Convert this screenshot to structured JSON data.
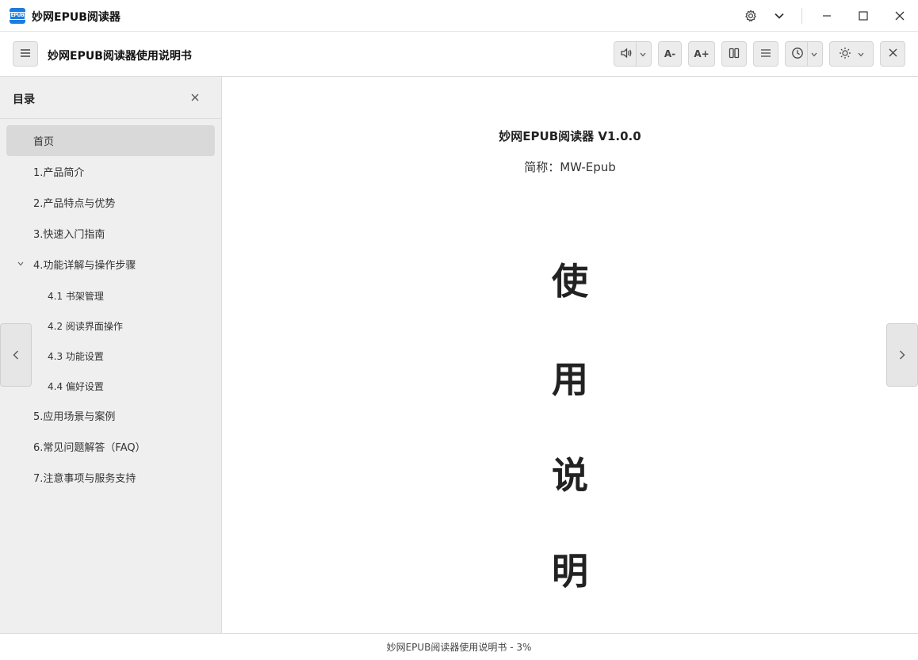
{
  "window": {
    "app_logo_text": "EPUB",
    "title": "妙网EPUB阅读器",
    "icons": [
      "gear-icon",
      "chevron-down-icon",
      "minimize-icon",
      "maximize-icon",
      "close-icon"
    ]
  },
  "toolbar": {
    "doc_title": "妙网EPUB阅读器使用说明书",
    "font_decrease_label": "A-",
    "font_increase_label": "A+",
    "icons": [
      "menu-icon",
      "speaker-icon",
      "two-column-icon",
      "list-icon",
      "clock-icon",
      "sun-icon",
      "close-icon"
    ]
  },
  "sidebar": {
    "title": "目录",
    "items": [
      {
        "label": "首页",
        "level": 0,
        "active": true
      },
      {
        "label": "1.产品简介",
        "level": 0
      },
      {
        "label": "2.产品特点与优势",
        "level": 0
      },
      {
        "label": "3.快速入门指南",
        "level": 0
      },
      {
        "label": "4.功能详解与操作步骤",
        "level": 0,
        "expanded": true
      },
      {
        "label": "4.1 书架管理",
        "level": 1
      },
      {
        "label": "4.2 阅读界面操作",
        "level": 1
      },
      {
        "label": "4.3 功能设置",
        "level": 1
      },
      {
        "label": "4.4 偏好设置",
        "level": 1
      },
      {
        "label": "5.应用场景与案例",
        "level": 0
      },
      {
        "label": "6.常见问题解答（FAQ）",
        "level": 0
      },
      {
        "label": "7.注意事项与服务支持",
        "level": 0
      }
    ]
  },
  "content": {
    "book_title": "妙网EPUB阅读器 V1.0.0",
    "subtitle": "简称：MW-Epub",
    "big_chars": [
      "使",
      "用",
      "说",
      "明"
    ]
  },
  "status": {
    "text": "妙网EPUB阅读器使用说明书 - 3%"
  },
  "colors": {
    "accent": "#1e7ce0",
    "sidebar_bg": "#efefef",
    "active_item_bg": "#d9d9d9"
  }
}
